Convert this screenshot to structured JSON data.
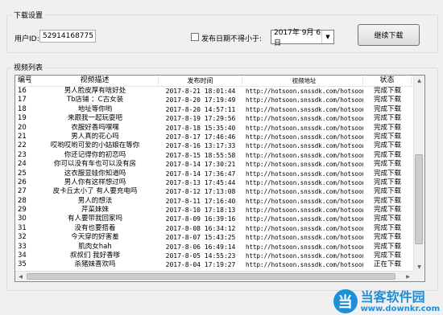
{
  "settings": {
    "title": "下载设置",
    "user_id_label": "用户ID:",
    "user_id_value": "52914168775",
    "date_filter_label": "发布日期不得小于:",
    "date_value": "2017年 9月 6日",
    "continue_button": "继续下载"
  },
  "video_list": {
    "title": "视频列表",
    "columns": [
      "编号",
      "视频描述",
      "发布时间",
      "视频地址",
      "状态"
    ],
    "rows": [
      [
        "16",
        "男人脸皮厚有啥好处",
        "2017-8-21 18:01:44",
        "http://hotsoon.snssdk.com/hotsoon/i...",
        "完成下载"
      ],
      [
        "17",
        "Tb店铺 ：C古女装",
        "2017-8-20 17:19:49",
        "http://hotsoon.snssdk.com/hotsoon/i...",
        "完成下载"
      ],
      [
        "18",
        "地址等你哟",
        "2017-8-20 14:57:11",
        "http://hotsoon.snssdk.com/hotsoon/i...",
        "完成下载"
      ],
      [
        "19",
        "来跟我一起玩耍吧",
        "2017-8-19 17:29:56",
        "http://hotsoon.snssdk.com/hotsoon/i...",
        "完成下载"
      ],
      [
        "20",
        "衣服好香吗嘿嘿",
        "2017-8-18 15:35:40",
        "http://hotsoon.snssdk.com/hotsoon/i...",
        "完成下载"
      ],
      [
        "21",
        "男人真的花心吗",
        "2017-8-17 17:46:46",
        "http://hotsoon.snssdk.com/hotsoon/i...",
        "完成下载"
      ],
      [
        "22",
        "哎哟哎哟可爱的小姑娘在等你",
        "2017-8-16 13:17:33",
        "http://hotsoon.snssdk.com/hotsoon/i...",
        "完成下载"
      ],
      [
        "23",
        "你还记得你的初恋吗",
        "2017-8-15 18:55:58",
        "http://hotsoon.snssdk.com/hotsoon/i...",
        "完成下载"
      ],
      [
        "24",
        "你可以没有车也可以没有房",
        "2017-8-14 17:30:21",
        "http://hotsoon.snssdk.com/hotsoon/i...",
        "完成下载"
      ],
      [
        "25",
        "这衣服显娃你知道吗",
        "2017-8-14 17:36:47",
        "http://hotsoon.snssdk.com/hotsoon/i...",
        "完成下载"
      ],
      [
        "26",
        "男人你有这样想过吗",
        "2017-8-13 17:45:44",
        "http://hotsoon.snssdk.com/hotsoon/i...",
        "完成下载"
      ],
      [
        "27",
        "皮卡丘太小了 有人要充电吗",
        "2017-8-12 17:13:08",
        "http://hotsoon.snssdk.com/hotsoon/i...",
        "完成下载"
      ],
      [
        "28",
        "男人的想法",
        "2017-8-11 17:16:40",
        "http://hotsoon.snssdk.com/hotsoon/i...",
        "完成下载"
      ],
      [
        "29",
        "芹菜妹妹",
        "2017-8-10 17:18:13",
        "http://hotsoon.snssdk.com/hotsoon/i...",
        "完成下载"
      ],
      [
        "30",
        "有人要带我回家吗",
        "2017-8-09 16:39:16",
        "http://hotsoon.snssdk.com/hotsoon/i...",
        "完成下载"
      ],
      [
        "31",
        "没有也要搭着",
        "2017-8-08 16:34:12",
        "http://hotsoon.snssdk.com/hotsoon/i...",
        "完成下载"
      ],
      [
        "32",
        "今天穿的好害羞",
        "2017-8-07 15:43:25",
        "http://hotsoon.snssdk.com/hotsoon/i...",
        "完成下载"
      ],
      [
        "33",
        "肌肉女hah",
        "2017-8-06 16:49:14",
        "http://hotsoon.snssdk.com/hotsoon/i...",
        "完成下载"
      ],
      [
        "34",
        "叔叔们 我好香嗲",
        "2017-8-05 14:55:23",
        "http://hotsoon.snssdk.com/hotsoon/i...",
        "完成下载"
      ],
      [
        "35",
        "杀猪妹喜欢吗",
        "2017-8-04 17:19:27",
        "http://hotsoon.snssdk.com/hotsoon/i...",
        "正在下载"
      ]
    ]
  },
  "watermark": {
    "logo_char": "当",
    "name": "当客软件园",
    "url": "www.downkr.com"
  },
  "colors": {
    "window_bg": "#f0f0f0",
    "group_border": "#d5dfe5",
    "watermark_blue": "#1d8fd9"
  }
}
